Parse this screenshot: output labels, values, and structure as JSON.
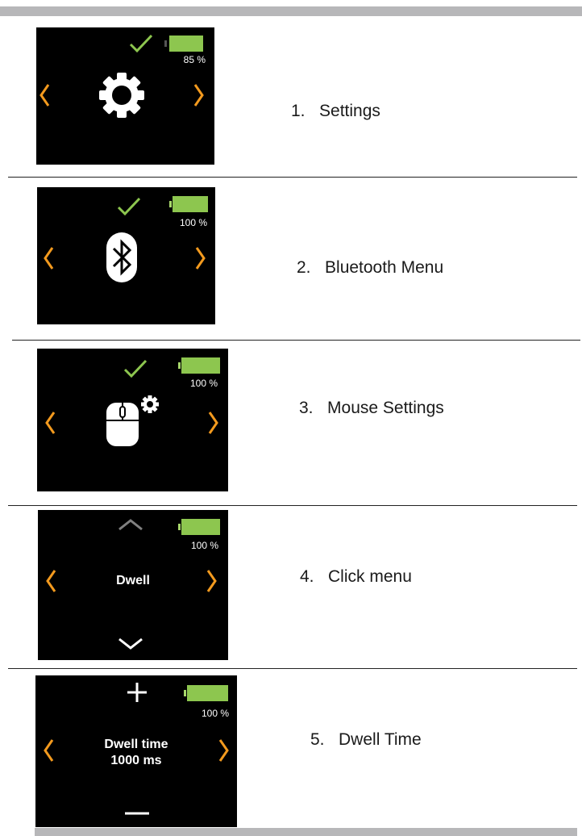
{
  "rows": [
    {
      "caption": "1.   Settings",
      "battery": "85 %",
      "icon": "gear-icon"
    },
    {
      "caption": "2.   Bluetooth Menu",
      "battery": "100 %",
      "icon": "bluetooth-icon"
    },
    {
      "caption": "3.   Mouse Settings",
      "battery": "100 %",
      "icon": "mouse-settings-icon"
    },
    {
      "caption": "4.   Click menu",
      "battery": "100 %",
      "menu_text": "Dwell"
    },
    {
      "caption": "5.   Dwell Time",
      "battery": "100 %",
      "menu_text_line1": "Dwell time",
      "menu_text_line2": "1000 ms"
    }
  ],
  "colors": {
    "accent": "#f39a1e",
    "check": "#8dc64f",
    "battery": "#8dc64f",
    "screen": "#000000"
  }
}
